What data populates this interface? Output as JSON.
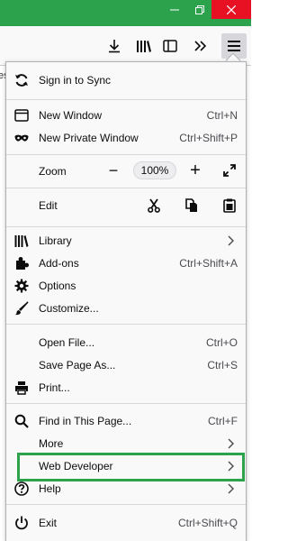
{
  "window": {
    "titlebar_color": "#2ca24c",
    "controls": [
      "minimize-icon",
      "restore-icon",
      "close-icon"
    ]
  },
  "toolbar": {
    "page_fragment": "es",
    "buttons": [
      "download-icon",
      "library-icon",
      "sidebar-icon",
      "overflow-icon",
      "hamburger-menu-icon"
    ]
  },
  "menu": {
    "sign_in": "Sign in to Sync",
    "new_window": "New Window",
    "new_window_shortcut": "Ctrl+N",
    "new_private_window": "New Private Window",
    "new_private_window_shortcut": "Ctrl+Shift+P",
    "zoom_label": "Zoom",
    "zoom_value": "100%",
    "zoom_out": "−",
    "zoom_in": "+",
    "edit_label": "Edit",
    "library": "Library",
    "addons": "Add-ons",
    "addons_shortcut": "Ctrl+Shift+A",
    "options": "Options",
    "customize": "Customize...",
    "open_file": "Open File...",
    "open_file_shortcut": "Ctrl+O",
    "save_page": "Save Page As...",
    "save_page_shortcut": "Ctrl+S",
    "print": "Print...",
    "find": "Find in This Page...",
    "find_shortcut": "Ctrl+F",
    "more": "More",
    "web_developer": "Web Developer",
    "help": "Help",
    "exit": "Exit",
    "exit_shortcut": "Ctrl+Shift+Q"
  },
  "colors": {
    "highlight": "#2ca24c",
    "menu_bg": "#f9f9fa",
    "close_button": "#e81123"
  }
}
